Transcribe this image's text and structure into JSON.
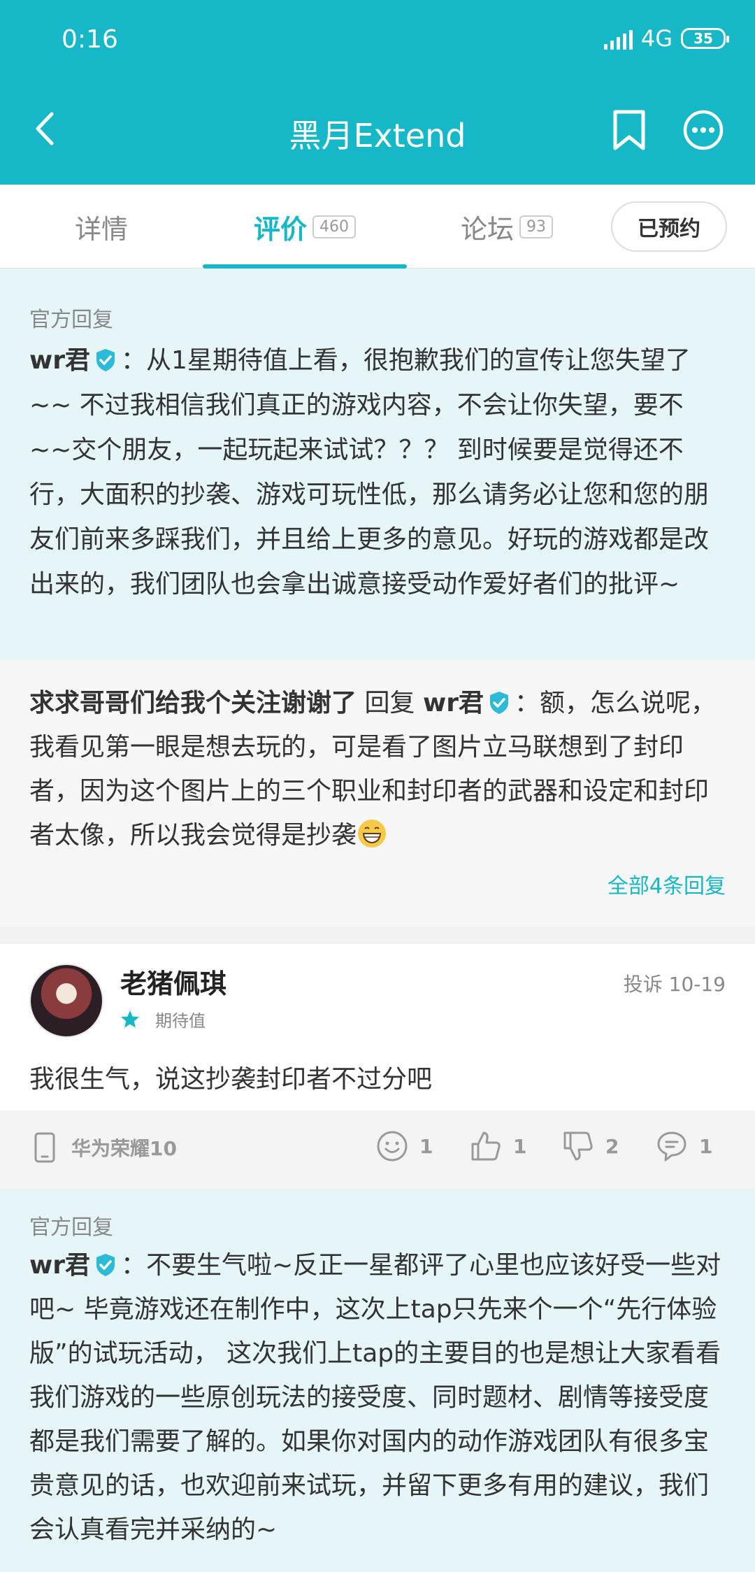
{
  "status_bar": {
    "time": "0:16",
    "network": "4G",
    "network_sub": "↑↓",
    "battery": "35"
  },
  "header": {
    "title": "黑月Extend"
  },
  "tabs": [
    {
      "label": "详情",
      "count": ""
    },
    {
      "label": "评价",
      "count": "460"
    },
    {
      "label": "论坛",
      "count": "93"
    }
  ],
  "reserve_label": "已预约",
  "official_reply_1": {
    "label": "官方回复",
    "user": "wr君",
    "text": "：从1星期待值上看，很抱歉我们的宣传让您失望了~~ 不过我相信我们真正的游戏内容，不会让你失望，要不~~交个朋友，一起玩起来试试？？？ 到时候要是觉得还不行，大面积的抄袭、游戏可玩性低，那么请务必让您和您的朋友们前来多踩我们，并且给上更多的意见。好玩的游戏都是改出来的，我们团队也会拿出诚意接受动作爱好者们的批评~"
  },
  "user_reply": {
    "user": "求求哥哥们给我个关注谢谢了",
    "reply_word": "回复",
    "target": "wr君",
    "text": "：额，怎么说呢，我看见第一眼是想去玩的，可是看了图片立马联想到了封印者，因为这个图片上的三个职业和封印者的武器和设定和封印者太像，所以我会觉得是抄袭",
    "more_label": "全部4条回复"
  },
  "review": {
    "user": "老猪佩琪",
    "report_label": "投诉",
    "date": "10-19",
    "stars": 1,
    "rating_label": "期待值",
    "text": "我很生气，说这抄袭封印者不过分吧",
    "device": "华为荣耀10",
    "counts": {
      "fun": "1",
      "like": "1",
      "dislike": "2",
      "comment": "1"
    }
  },
  "official_reply_2": {
    "label": "官方回复",
    "user": "wr君",
    "text": "：不要生气啦~反正一星都评了心里也应该好受一些对吧~ 毕竟游戏还在制作中，这次上tap只先来个一个“先行体验版”的试玩活动， 这次我们上tap的主要目的也是想让大家看看我们游戏的一些原创玩法的接受度、同时题材、剧情等接受度都是我们需要了解的。如果你对国内的动作游戏团队有很多宝贵意见的话，也欢迎前来试玩，并留下更多有用的建议，我们会认真看完并采纳的~"
  },
  "colors": {
    "accent": "#16b8c8",
    "official_bg": "#e6f5f8"
  }
}
